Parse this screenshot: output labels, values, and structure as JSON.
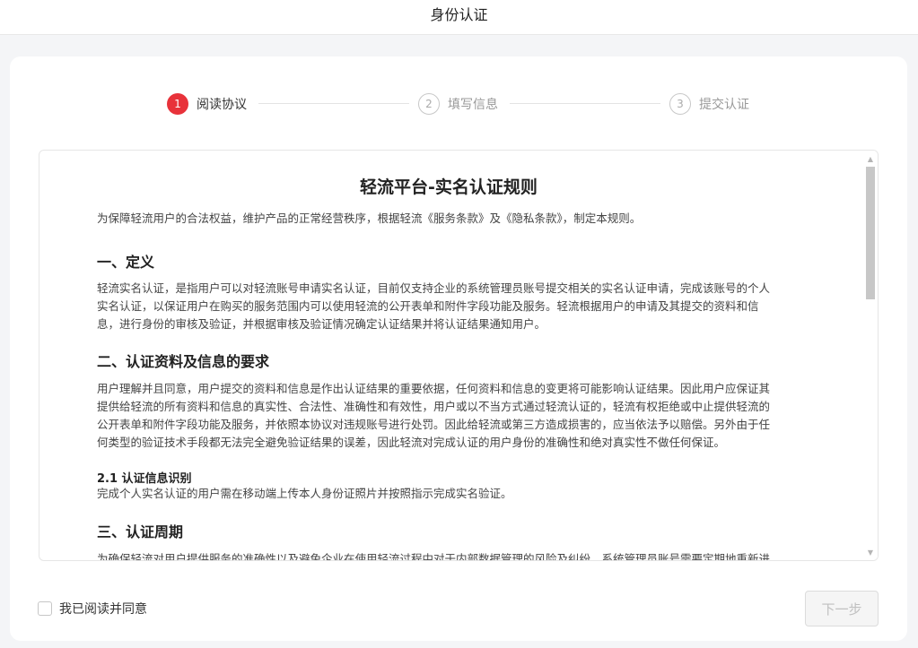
{
  "header": {
    "title": "身份认证"
  },
  "steps": [
    {
      "num": "1",
      "label": "阅读协议"
    },
    {
      "num": "2",
      "label": "填写信息"
    },
    {
      "num": "3",
      "label": "提交认证"
    }
  ],
  "document": {
    "title": "轻流平台-实名认证规则",
    "intro": "为保障轻流用户的合法权益，维护产品的正常经营秩序，根据轻流《服务条款》及《隐私条款》，制定本规则。",
    "sections": [
      {
        "heading": "一、定义",
        "lines": [
          "轻流实名认证，是指用户可以对轻流账号申请实名认证，目前仅支持企业的系统管理员账号提交相关的实名认证申请，完成该账号的个人",
          "实名认证，以保证用户在购买的服务范围内可以使用轻流的公开表单和附件字段功能及服务。轻流根据用户的申请及其提交的资料和信",
          "息，进行身份的审核及验证，并根据审核及验证情况确定认证结果并将认证结果通知用户。"
        ]
      },
      {
        "heading": "二、认证资料及信息的要求",
        "lines": [
          "用户理解并且同意，用户提交的资料和信息是作出认证结果的重要依据，任何资料和信息的变更将可能影响认证结果。因此用户应保证其",
          "提供给轻流的所有资料和信息的真实性、合法性、准确性和有效性，用户或以不当方式通过轻流认证的，轻流有权拒绝或中止提供轻流的",
          "公开表单和附件字段功能及服务，并依照本协议对违规账号进行处罚。因此给轻流或第三方造成损害的，应当依法予以赔偿。另外由于任",
          "何类型的验证技术手段都无法完全避免验证结果的误差，因此轻流对完成认证的用户身份的准确性和绝对真实性不做任何保证。"
        ],
        "sub_heading": "2.1 认证信息识别",
        "sub_text": "完成个人实名认证的用户需在移动端上传本人身份证照片并按照指示完成实名验证。"
      },
      {
        "heading": "三、认证周期",
        "lines": [
          "为确保轻流对用户提供服务的准确性以及避免企业在使用轻流过程中对于内部数据管理的风险及纠纷，系统管理员账号需要定期地重新进"
        ]
      }
    ]
  },
  "footer": {
    "agree_label": "我已阅读并同意",
    "next_label": "下一步"
  },
  "icons": {
    "scroll_up": "triangle-up-icon",
    "scroll_down": "triangle-down-icon"
  },
  "colors": {
    "accent": "#e8323a"
  }
}
